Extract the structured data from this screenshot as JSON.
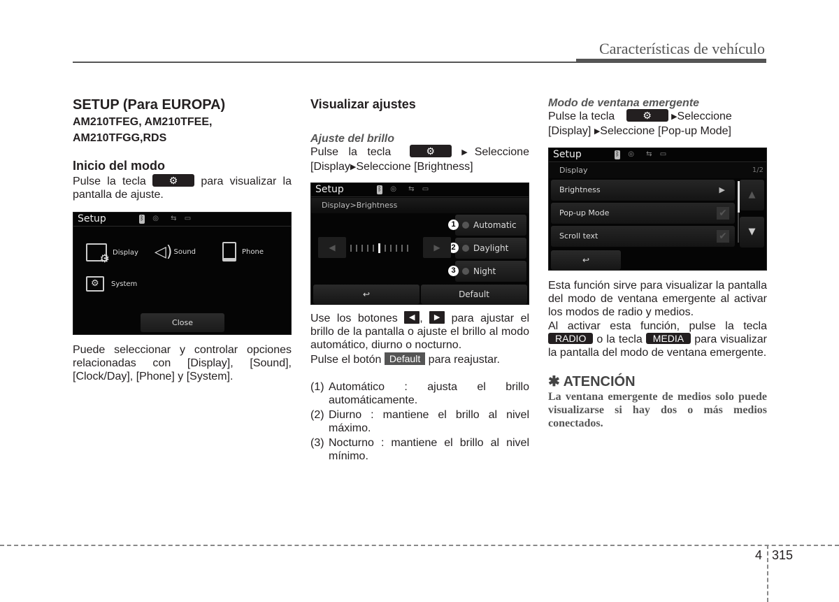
{
  "header": {
    "section_title": "Características de vehículo"
  },
  "col1": {
    "title": "SETUP (Para EUROPA)",
    "models_line1": "AM210TFEG, AM210TFEE,",
    "models_line2": "AM210TFGG,RDS",
    "section": "Inicio del modo",
    "intro_pre": "Pulse la tecla",
    "intro_post": "para visualizar la pantalla de ajuste.",
    "gear_key": "⚙",
    "screen": {
      "title": "Setup",
      "items": [
        {
          "label": "Display",
          "icon": "display-gear-icon"
        },
        {
          "label": "Sound",
          "icon": "speaker-icon"
        },
        {
          "label": "Phone",
          "icon": "phone-icon"
        },
        {
          "label": "System",
          "icon": "folder-gear-icon"
        }
      ],
      "close_label": "Close"
    },
    "body": "Puede seleccionar y controlar opciones relacionadas con [Display], [Sound], [Clock/Day], [Phone] y [System]."
  },
  "col2": {
    "section": "Visualizar ajustes",
    "subsection": "Ajuste del brillo",
    "intro_pre": "Pulse la tecla",
    "intro_mid": "Seleccione [Display",
    "intro_post": "Seleccione [Brightness]",
    "gear_key": "⚙",
    "screen": {
      "title": "Setup",
      "breadcrumb": "Display>Brightness",
      "options": [
        {
          "num": "1",
          "label": "Automatic"
        },
        {
          "num": "2",
          "label": "Daylight"
        },
        {
          "num": "3",
          "label": "Night"
        }
      ],
      "slider_ticks": 11,
      "slider_level": 6,
      "back_icon": "↩",
      "default_label": "Default"
    },
    "p1_pre": "Use los botones",
    "p1_sep": ",",
    "p1_post": "para ajustar el brillo de la pantalla o ajuste el brillo al modo automático, diurno o nocturno.",
    "left_key": "◀",
    "right_key": "▶",
    "p2_pre": "Pulse el botón",
    "default_key": "Default",
    "p2_post": "para reajustar.",
    "list": [
      {
        "num": "(1)",
        "text": "Automático : ajusta el brillo automáticamente."
      },
      {
        "num": "(2)",
        "text": "Diurno : mantiene el brillo al nivel máximo."
      },
      {
        "num": "(3)",
        "text": "Nocturno : mantiene el brillo al nivel mínimo."
      }
    ]
  },
  "col3": {
    "subsection": "Modo de ventana emergente",
    "intro_pre": "Pulse la tecla",
    "intro_mid": "Seleccione",
    "intro_line2_pre": "[Display]",
    "intro_line2_post": "Seleccione [Pop-up Mode]",
    "gear_key": "⚙",
    "screen": {
      "title": "Setup",
      "breadcrumb": "Display",
      "page": "1/2",
      "rows": [
        {
          "label": "Brightness",
          "end": "▶"
        },
        {
          "label": "Pop-up Mode",
          "end": "✔"
        },
        {
          "label": "Scroll text",
          "end": "✔"
        }
      ],
      "up": "▲",
      "down": "▼",
      "back_icon": "↩"
    },
    "p1": "Esta función sirve para visualizar la pantalla del modo de ventana emergente al activar los modos de radio y medios.",
    "p2_pre": "Al activar esta función, pulse la tecla",
    "radio_key": "RADIO",
    "p2_mid": "o la tecla",
    "media_key": "MEDIA",
    "p2_post": "para visualizar la pantalla del modo de ventana emergente.",
    "attention_title": "✱ ATENCIÓN",
    "attention_body": "La ventana emergente de medios solo puede visualizarse si hay dos o más medios conectados."
  },
  "footer": {
    "chapter": "4",
    "page": "315"
  }
}
